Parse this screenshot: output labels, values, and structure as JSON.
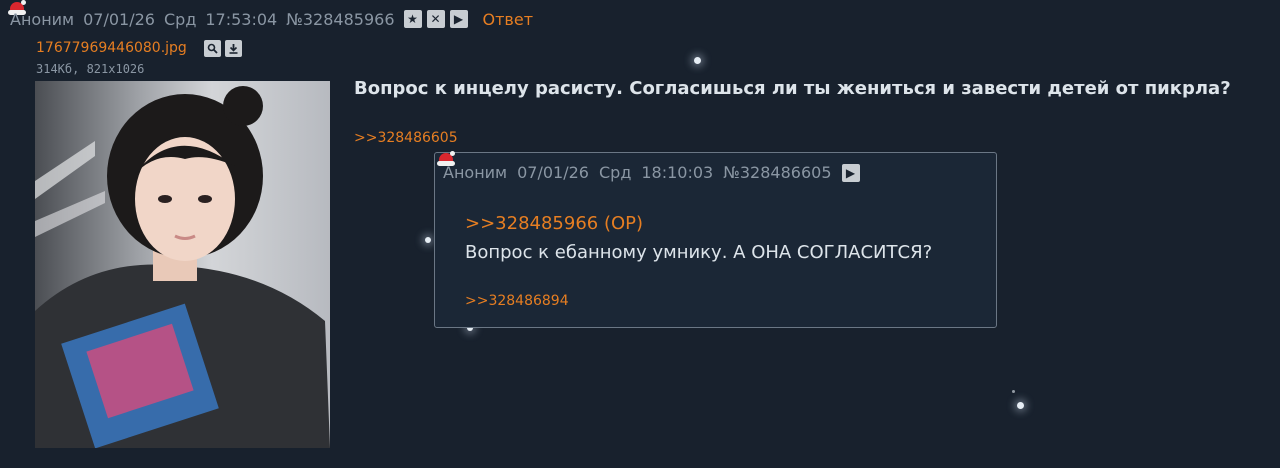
{
  "post": {
    "author": "Аноним",
    "date": "07/01/26",
    "weekday": "Срд",
    "time": "17:53:04",
    "number": "№328485966",
    "reply_label": "Ответ",
    "icons": [
      "star-icon",
      "close-icon",
      "play-icon"
    ]
  },
  "file": {
    "name": "17677969446080.jpg",
    "meta": "314Кб, 821x1026",
    "icons": [
      "search-icon",
      "download-icon"
    ]
  },
  "op": {
    "text": "Вопрос к инцелу расисту. Согласишься ли ты жениться и завести детей от пикрла?",
    "reply_ref": ">>328486605"
  },
  "popup": {
    "author": "Аноним",
    "date": "07/01/26",
    "weekday": "Срд",
    "time": "18:10:03",
    "number": "№328486605",
    "quote": ">>328485966 (OP)",
    "text": "Вопрос к ебанному умнику. А ОНА СОГЛАСИТСЯ?",
    "reply_ref": ">>328486894"
  },
  "colors": {
    "background": "#18212d",
    "link": "#e67e22",
    "text": "#dde4ea",
    "muted": "#8a96a3"
  }
}
